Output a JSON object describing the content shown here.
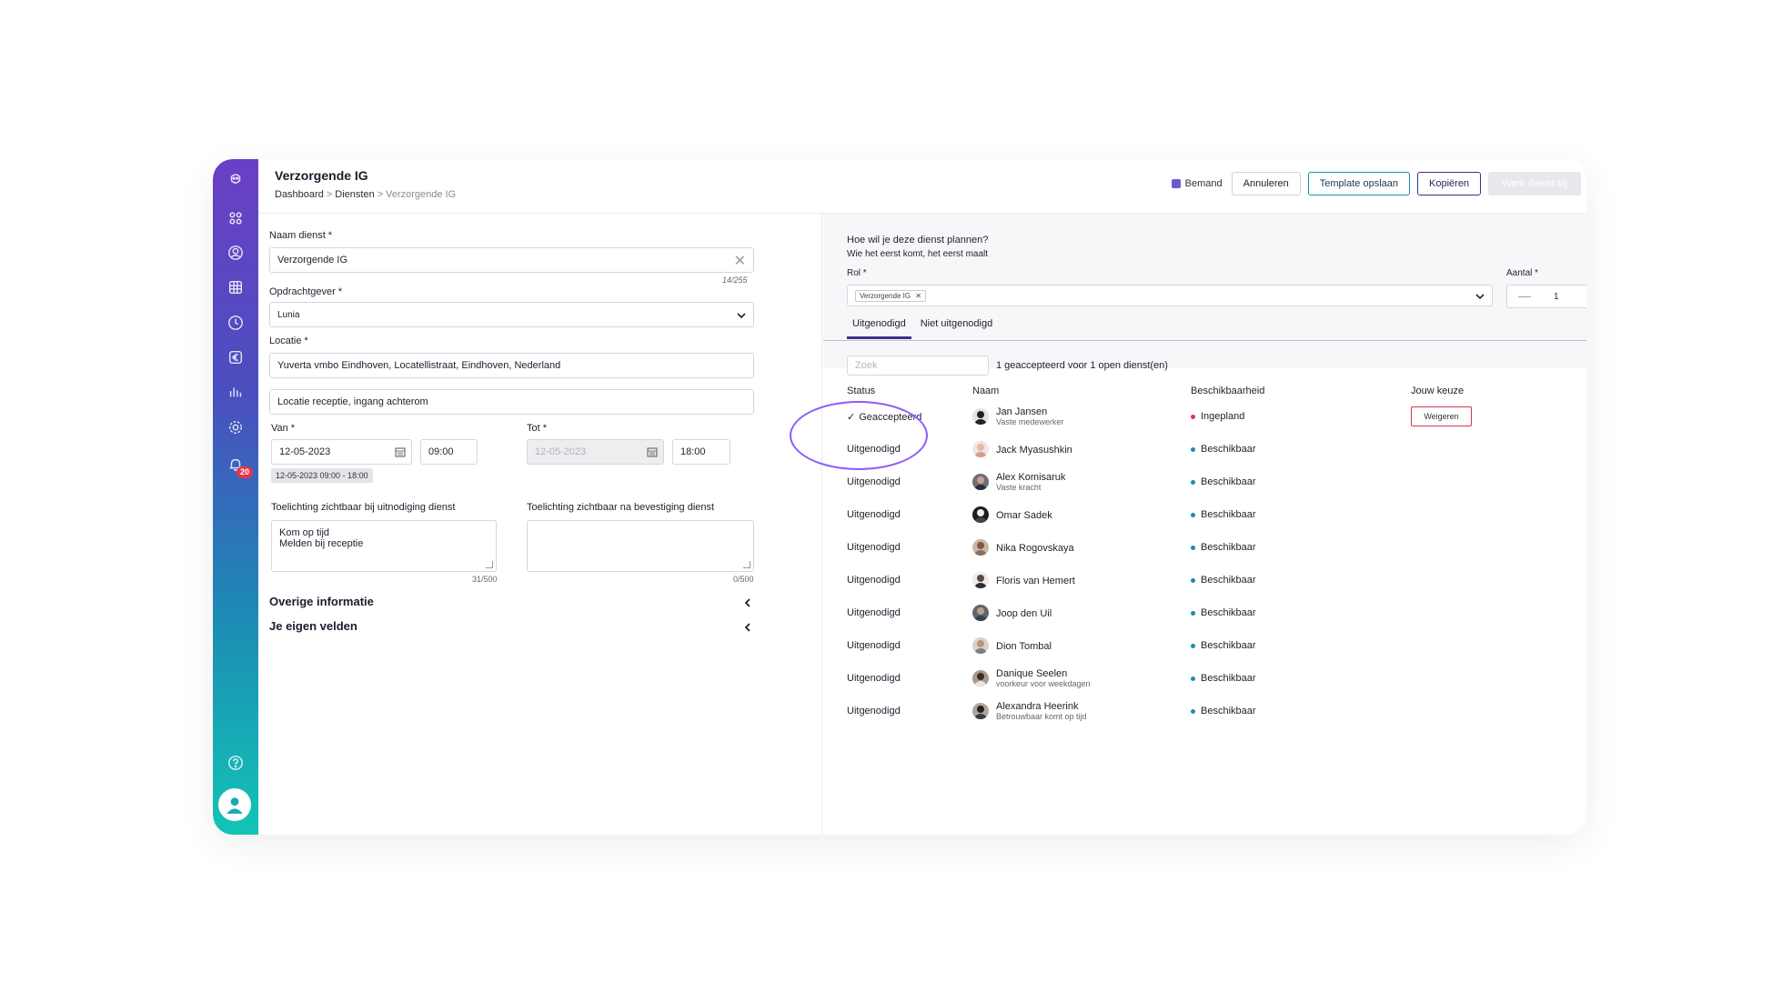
{
  "header": {
    "title": "Verzorgende IG",
    "breadcrumb": [
      "Dashboard",
      "Diensten",
      "Verzorgende IG"
    ],
    "legend_label": "Bemand",
    "legend_color": "#6b5bd2",
    "buttons": {
      "cancel": "Annuleren",
      "save_template": "Template opslaan",
      "copy": "Kopiëren",
      "update": "Werk dienst bij"
    }
  },
  "sidebar": {
    "icons": [
      "logo-icon",
      "apps-icon",
      "user-circle-icon",
      "calendar-grid-icon",
      "clock-icon",
      "euro-icon",
      "bar-chart-icon",
      "settings-icon",
      "bell-icon",
      "help-icon",
      "avatar-icon"
    ],
    "notification_count": "20"
  },
  "form": {
    "name_label": "Naam dienst *",
    "name_value": "Verzorgende IG",
    "name_counter": "14/255",
    "client_label": "Opdrachtgever *",
    "client_value": "Lunia",
    "location_label": "Locatie *",
    "location_value": "Yuverta vmbo Eindhoven, Locatellistraat, Eindhoven, Nederland",
    "location_detail": "Locatie receptie, ingang achterom",
    "from_label": "Van *",
    "from_date": "12-05-2023",
    "from_time": "09:00",
    "range_chip": "12-05-2023 09:00 - 18:00",
    "to_label": "Tot *",
    "to_date": "12-05-2023",
    "to_time": "18:00",
    "invite_note_label": "Toelichting zichtbaar bij uitnodiging dienst",
    "invite_note_lines": [
      "Kom op tijd",
      "Melden bij receptie"
    ],
    "invite_note_counter": "31/500",
    "confirm_note_label": "Toelichting zichtbaar na bevestiging dienst",
    "confirm_note_counter": "0/500",
    "section_other": "Overige informatie",
    "section_custom": "Je eigen velden"
  },
  "planning": {
    "question": "Hoe wil je deze dienst plannen?",
    "mode": "Wie het eerst komt, het eerst maalt",
    "role_label": "Rol *",
    "role_tag": "Verzorgende IG",
    "amount_label": "Aantal *",
    "amount_value": "1",
    "tabs": [
      "Uitgenodigd",
      "Niet uitgenodigd"
    ],
    "search_placeholder": "Zoek",
    "summary": "1 geaccepteerd voor 1 open dienst(en)",
    "columns": [
      "Status",
      "Naam",
      "Beschikbaarheid",
      "Jouw keuze"
    ],
    "reject_label": "Weigeren",
    "rows": [
      {
        "status": "Geaccepteerd",
        "name": "Jan Jansen",
        "sub": "Vaste medewerker",
        "availability": "Ingepland",
        "dot_color": "#e0334d"
      },
      {
        "status": "Uitgenodigd",
        "name": "Jack Myasushkin",
        "sub": "",
        "availability": "Beschikbaar",
        "dot_color": "#1b8fa3"
      },
      {
        "status": "Uitgenodigd",
        "name": "Alex Komisaruk",
        "sub": "Vaste kracht",
        "availability": "Beschikbaar",
        "dot_color": "#1b8fa3"
      },
      {
        "status": "Uitgenodigd",
        "name": "Omar Sadek",
        "sub": "",
        "availability": "Beschikbaar",
        "dot_color": "#1b8fa3"
      },
      {
        "status": "Uitgenodigd",
        "name": "Nika Rogovskaya",
        "sub": "",
        "availability": "Beschikbaar",
        "dot_color": "#1b8fa3"
      },
      {
        "status": "Uitgenodigd",
        "name": "Floris van Hemert",
        "sub": "",
        "availability": "Beschikbaar",
        "dot_color": "#1b8fa3"
      },
      {
        "status": "Uitgenodigd",
        "name": "Joop den Uil",
        "sub": "",
        "availability": "Beschikbaar",
        "dot_color": "#1b8fa3"
      },
      {
        "status": "Uitgenodigd",
        "name": "Dion Tombal",
        "sub": "",
        "availability": "Beschikbaar",
        "dot_color": "#1b8fa3"
      },
      {
        "status": "Uitgenodigd",
        "name": "Danique Seelen",
        "sub": "voorkeur voor weekdagen",
        "availability": "Beschikbaar",
        "dot_color": "#1b8fa3"
      },
      {
        "status": "Uitgenodigd",
        "name": "Alexandra Heerink",
        "sub": "Betrouwbaar komt op tijd",
        "availability": "Beschikbaar",
        "dot_color": "#1b8fa3"
      }
    ]
  }
}
